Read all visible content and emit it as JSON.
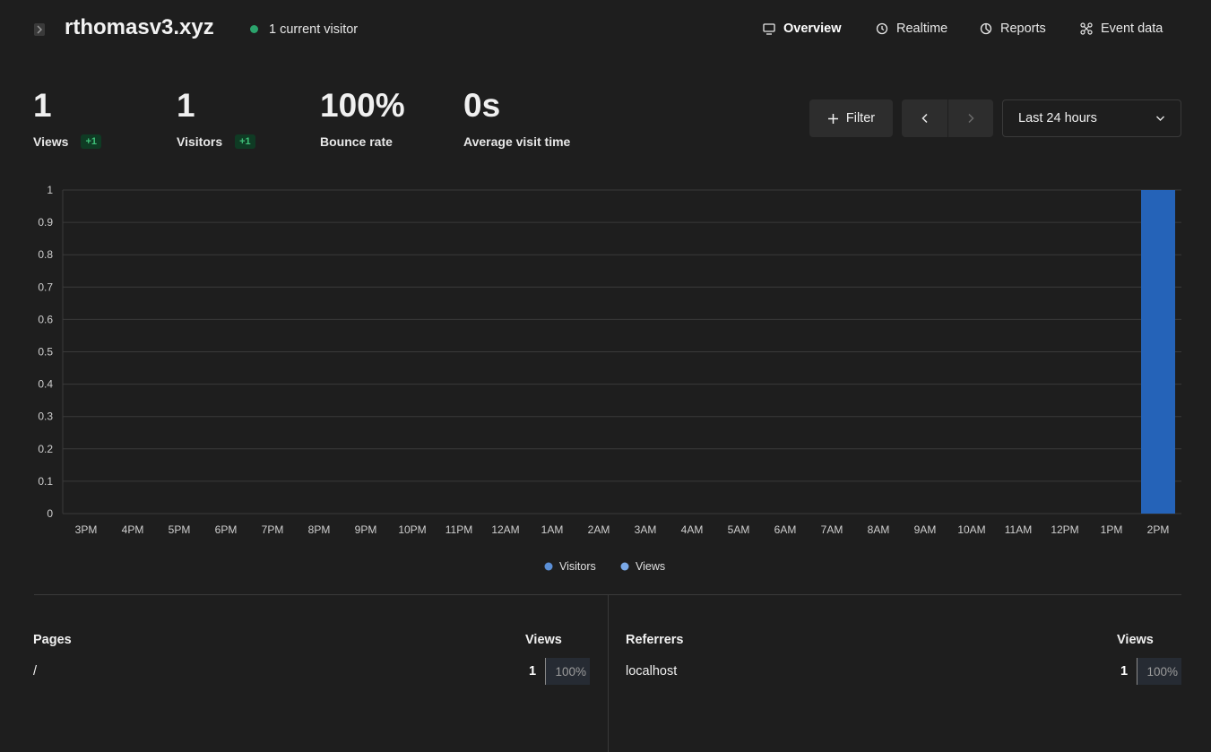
{
  "header": {
    "site_title": "rthomasv3.xyz",
    "live_visitors": "1 current visitor",
    "nav": [
      {
        "label": "Overview",
        "icon": "monitor-icon"
      },
      {
        "label": "Realtime",
        "icon": "clock-icon"
      },
      {
        "label": "Reports",
        "icon": "pie-chart-icon"
      },
      {
        "label": "Event data",
        "icon": "nodes-icon"
      }
    ]
  },
  "metrics": [
    {
      "value": "1",
      "label": "Views",
      "change": "+1"
    },
    {
      "value": "1",
      "label": "Visitors",
      "change": "+1"
    },
    {
      "value": "100%",
      "label": "Bounce rate"
    },
    {
      "value": "0s",
      "label": "Average visit time"
    }
  ],
  "toolbar": {
    "filter_label": "Filter",
    "date_range": "Last 24 hours"
  },
  "colors": {
    "accent": "#2563b8",
    "background": "#1e1e1e",
    "live_dot": "#2ba36c",
    "badge_text": "#3fbf78"
  },
  "chart_data": {
    "type": "bar",
    "categories": [
      "3PM",
      "4PM",
      "5PM",
      "6PM",
      "7PM",
      "8PM",
      "9PM",
      "10PM",
      "11PM",
      "12AM",
      "1AM",
      "2AM",
      "3AM",
      "4AM",
      "5AM",
      "6AM",
      "7AM",
      "8AM",
      "9AM",
      "10AM",
      "11AM",
      "12PM",
      "1PM",
      "2PM"
    ],
    "series": [
      {
        "name": "Visitors",
        "values": [
          0,
          0,
          0,
          0,
          0,
          0,
          0,
          0,
          0,
          0,
          0,
          0,
          0,
          0,
          0,
          0,
          0,
          0,
          0,
          0,
          0,
          0,
          0,
          1
        ],
        "color": "#5b8fd6"
      },
      {
        "name": "Views",
        "values": [
          0,
          0,
          0,
          0,
          0,
          0,
          0,
          0,
          0,
          0,
          0,
          0,
          0,
          0,
          0,
          0,
          0,
          0,
          0,
          0,
          0,
          0,
          0,
          1
        ],
        "color": "#7aa9e8"
      }
    ],
    "ylim": [
      0,
      1
    ],
    "yticks": [
      "0",
      "0.1",
      "0.2",
      "0.3",
      "0.4",
      "0.5",
      "0.6",
      "0.7",
      "0.8",
      "0.9",
      "1"
    ],
    "grid": true,
    "legend": "bottom-center"
  },
  "tables": {
    "pages": {
      "title": "Pages",
      "metric": "Views",
      "rows": [
        {
          "label": "/",
          "count": "1",
          "percent": "100%"
        }
      ]
    },
    "referrers": {
      "title": "Referrers",
      "metric": "Views",
      "rows": [
        {
          "label": "localhost",
          "count": "1",
          "percent": "100%"
        }
      ]
    }
  }
}
